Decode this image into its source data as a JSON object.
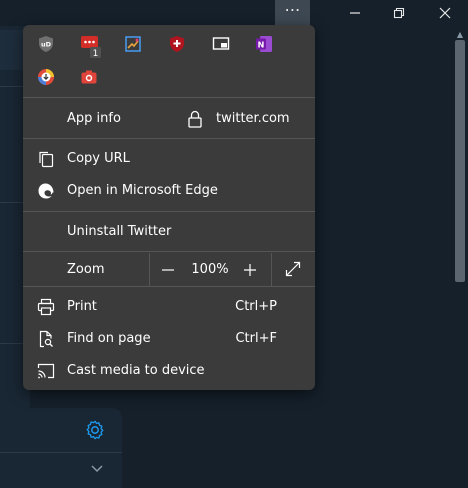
{
  "titlebar": {
    "more_glyph": "⋯",
    "minimize_glyph": "—",
    "restore_glyph": "❐",
    "close_glyph": "✕"
  },
  "menu": {
    "extensions": [
      {
        "name": "ublock-origin-icon",
        "label": "UD",
        "color": "#707070"
      },
      {
        "name": "lastpass-icon",
        "label": "•••",
        "color": "#d32d27",
        "badge": "1"
      },
      {
        "name": "color-picker-icon",
        "label": "",
        "color": "#e8a33d"
      },
      {
        "name": "medical-shield-icon",
        "label": "+",
        "color": "#b0141e"
      },
      {
        "name": "picture-in-picture-icon",
        "label": "",
        "color": "#3b3b3b"
      },
      {
        "name": "onenote-icon",
        "label": "N",
        "color": "#7719aa"
      },
      {
        "name": "downloader-icon",
        "label": "↓",
        "color": "#4c7ed9"
      },
      {
        "name": "screenshot-camera-icon",
        "label": "",
        "color": "#e0443a"
      }
    ],
    "app_info": {
      "label": "App info",
      "site": "twitter.com"
    },
    "copy_url": "Copy URL",
    "open_in_edge": "Open in Microsoft Edge",
    "uninstall": "Uninstall Twitter",
    "zoom": {
      "label": "Zoom",
      "minus": "—",
      "value": "100%",
      "plus": "+"
    },
    "print": {
      "label": "Print",
      "shortcut": "Ctrl+P"
    },
    "find": {
      "label": "Find on page",
      "shortcut": "Ctrl+F"
    },
    "cast": "Cast media to device"
  },
  "colors": {
    "menu_bg": "#3b3b3b",
    "page_bg": "#15202b",
    "accent": "#1d9bf0"
  }
}
